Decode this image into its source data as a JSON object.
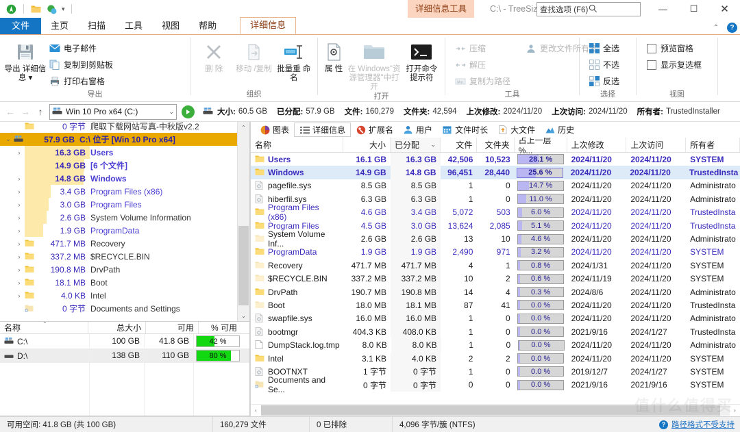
{
  "titlebar": {
    "context_tab_title": "详细信息工具",
    "window_title": "C:\\ - TreeSize",
    "search_placeholder": "查找选项 (F6)",
    "minimize": "—",
    "maximize": "☐",
    "close": "✕"
  },
  "ribbon_tabs": [
    {
      "label": "文件",
      "type": "file"
    },
    {
      "label": "主页",
      "type": "normal"
    },
    {
      "label": "扫描",
      "type": "normal"
    },
    {
      "label": "工具",
      "type": "normal"
    },
    {
      "label": "视图",
      "type": "normal"
    },
    {
      "label": "帮助",
      "type": "normal"
    },
    {
      "label": "详细信息",
      "type": "contextual"
    }
  ],
  "ribbon": {
    "groups": [
      {
        "label": "导出",
        "big": [
          {
            "label": "导出 详细信息 ▾",
            "icon": "save-disk-icon",
            "disabled": false
          }
        ],
        "small": [
          {
            "label": "电子邮件",
            "icon": "envelope-icon",
            "disabled": false
          },
          {
            "label": "复制到剪贴板",
            "icon": "copy-icon",
            "disabled": false
          },
          {
            "label": "打印右窗格",
            "icon": "printer-icon",
            "disabled": false
          }
        ]
      },
      {
        "label": "组织",
        "big": [
          {
            "label": "删 除",
            "icon": "delete-x-icon",
            "disabled": true
          },
          {
            "label": "移动 /复制",
            "icon": "move-copy-icon",
            "disabled": true
          },
          {
            "label": "批量重 命名",
            "icon": "rename-icon",
            "disabled": false
          }
        ],
        "small": []
      },
      {
        "label": "打开",
        "big": [
          {
            "label": "属 性",
            "icon": "properties-icon",
            "disabled": false
          },
          {
            "label": "在 Windows\"资 源管理器\"中打开",
            "icon": "folder-open-icon",
            "disabled": true
          },
          {
            "label": "打开命令 提示符",
            "icon": "console-icon",
            "disabled": false
          }
        ],
        "small": []
      },
      {
        "label": "工具",
        "big": [],
        "small": [
          {
            "label": "压缩",
            "icon": "compress-icon",
            "disabled": true
          },
          {
            "label": "解压",
            "icon": "extract-icon",
            "disabled": true
          },
          {
            "label": "复制为路径",
            "icon": "copy-path-icon",
            "disabled": true
          },
          {
            "label": "更改文件所有者",
            "icon": "change-owner-icon",
            "disabled": true
          }
        ]
      },
      {
        "label": "选择",
        "big": [],
        "small": [
          {
            "label": "全选",
            "icon": "select-all-icon",
            "disabled": false
          },
          {
            "label": "不选",
            "icon": "select-none-icon",
            "disabled": false
          },
          {
            "label": "反选",
            "icon": "invert-selection-icon",
            "disabled": false
          }
        ]
      },
      {
        "label": "视图",
        "big": [],
        "small": [
          {
            "label": "预览窗格",
            "icon": "checkbox-icon",
            "checked": false
          },
          {
            "label": "显示复选框",
            "icon": "checkbox-icon",
            "checked": false
          }
        ]
      }
    ]
  },
  "pathbar": {
    "back": "←",
    "forward": "→",
    "up": "↑",
    "drive_value": "Win 10 Pro x64 (C:)",
    "go": "▶",
    "info": [
      {
        "label": "大小:",
        "value": "60.5 GB"
      },
      {
        "label": "已分配:",
        "value": "57.9 GB"
      },
      {
        "label": "文件:",
        "value": "160,279"
      },
      {
        "label": "文件夹:",
        "value": "42,594"
      },
      {
        "label": "上次修改:",
        "value": "2024/11/20"
      },
      {
        "label": "上次访问:",
        "value": "2024/11/20"
      },
      {
        "label": "所有者:",
        "value": "TrustedInstaller"
      }
    ]
  },
  "tree": {
    "rows": [
      {
        "size": "0 字节",
        "name": "爬取下载网站写真-中秋版v2.2",
        "indent": 1,
        "expander": "",
        "icon": "folder-icon",
        "bar": 0,
        "clipped": true,
        "bold": false,
        "gray": true
      },
      {
        "size": "57.9 GB",
        "name": "C:\\ 位于  [Win 10 Pro x64]",
        "indent": 0,
        "expander": "⌄",
        "icon": "drive-icon",
        "bar": 0,
        "selected": true,
        "bold": true
      },
      {
        "size": "16.3 GB",
        "name": "Users",
        "indent": 1,
        "expander": "›",
        "icon": "folder-icon",
        "bar": 95,
        "bold": true
      },
      {
        "size": "14.9 GB",
        "name": "[6 个文件]",
        "indent": 1,
        "expander": "",
        "icon": "file-icon",
        "bar": 87,
        "bold": true
      },
      {
        "size": "14.8 GB",
        "name": "Windows",
        "indent": 1,
        "expander": "›",
        "icon": "folder-icon",
        "bar": 86,
        "bold": true
      },
      {
        "size": "3.4 GB",
        "name": "Program Files (x86)",
        "indent": 1,
        "expander": "›",
        "icon": "folder-icon",
        "bar": 38,
        "bold": false
      },
      {
        "size": "3.0 GB",
        "name": "Program Files",
        "indent": 1,
        "expander": "›",
        "icon": "folder-icon",
        "bar": 35,
        "bold": false
      },
      {
        "size": "2.6 GB",
        "name": "System Volume Information",
        "indent": 1,
        "expander": "›",
        "icon": "folder-icon",
        "bar": 32,
        "bold": false,
        "gray": true
      },
      {
        "size": "1.9 GB",
        "name": "ProgramData",
        "indent": 1,
        "expander": "›",
        "icon": "folder-icon",
        "bar": 27,
        "bold": false
      },
      {
        "size": "471.7 MB",
        "name": "Recovery",
        "indent": 1,
        "expander": "›",
        "icon": "folder-icon",
        "bar": 0,
        "bold": false,
        "gray": true
      },
      {
        "size": "337.2 MB",
        "name": "$RECYCLE.BIN",
        "indent": 1,
        "expander": "›",
        "icon": "folder-icon",
        "bar": 0,
        "bold": false,
        "gray": true
      },
      {
        "size": "190.8 MB",
        "name": "DrvPath",
        "indent": 1,
        "expander": "›",
        "icon": "folder-icon",
        "bar": 0,
        "bold": false,
        "gray": true
      },
      {
        "size": "18.1 MB",
        "name": "Boot",
        "indent": 1,
        "expander": "›",
        "icon": "folder-icon",
        "bar": 0,
        "bold": false,
        "gray": true
      },
      {
        "size": "4.0 KB",
        "name": "Intel",
        "indent": 1,
        "expander": "›",
        "icon": "folder-icon",
        "bar": 0,
        "bold": false,
        "gray": true
      },
      {
        "size": "0 字节",
        "name": "Documents and Settings",
        "indent": 1,
        "expander": "",
        "icon": "shortcut-folder-icon",
        "bar": 0,
        "bold": false,
        "gray": true
      }
    ]
  },
  "drives": {
    "headers": [
      "名称",
      "总大小",
      "可用",
      "% 可用"
    ],
    "rows": [
      {
        "name": "C:\\",
        "icon": "drive-icon",
        "total": "100 GB",
        "free": "41.8 GB",
        "pct": "42 %",
        "pct_value": 42
      },
      {
        "name": "D:\\",
        "icon": "drive-plain-icon",
        "total": "138 GB",
        "free": "110 GB",
        "pct": "80 %",
        "pct_value": 80
      }
    ]
  },
  "view_tabs": [
    {
      "label": "图表",
      "icon": "piechart-icon",
      "active": false
    },
    {
      "label": "详细信息",
      "icon": "details-icon",
      "active": true
    },
    {
      "label": "扩展名",
      "icon": "extension-icon",
      "active": false
    },
    {
      "label": "用户",
      "icon": "users-icon",
      "active": false
    },
    {
      "label": "文件时长",
      "icon": "calendar-icon",
      "active": false
    },
    {
      "label": "大文件",
      "icon": "topfiles-icon",
      "active": false
    },
    {
      "label": "历史",
      "icon": "history-icon",
      "active": false
    }
  ],
  "grid": {
    "headers": [
      {
        "label": "名称",
        "key": "name"
      },
      {
        "label": "大小",
        "key": "size"
      },
      {
        "label": "已分配",
        "key": "alloc",
        "sorted": true,
        "sort_glyph": "⌄"
      },
      {
        "label": "文件",
        "key": "files"
      },
      {
        "label": "文件夹",
        "key": "folders"
      },
      {
        "label": "占上一层 %...",
        "key": "pct"
      },
      {
        "label": "上次修改",
        "key": "modified"
      },
      {
        "label": "上次访问",
        "key": "accessed"
      },
      {
        "label": "所有者",
        "key": "owner"
      }
    ],
    "rows": [
      {
        "name": "Users",
        "icon": "folder-icon",
        "size": "16.1 GB",
        "alloc": "16.3 GB",
        "files": "42,506",
        "folders": "10,523",
        "pct": "28.1 %",
        "pct_value": 28.1,
        "modified": "2024/11/20",
        "accessed": "2024/11/20",
        "owner": "SYSTEM",
        "bold": true,
        "selected": false
      },
      {
        "name": "Windows",
        "icon": "folder-icon",
        "size": "14.9 GB",
        "alloc": "14.8 GB",
        "files": "96,451",
        "folders": "28,440",
        "pct": "25.6 %",
        "pct_value": 25.6,
        "modified": "2024/11/20",
        "accessed": "2024/11/20",
        "owner": "TrustedInsta",
        "bold": true,
        "selected": true
      },
      {
        "name": "pagefile.sys",
        "icon": "sysfile-icon",
        "size": "8.5 GB",
        "alloc": "8.5 GB",
        "files": "1",
        "folders": "0",
        "pct": "14.7 %",
        "pct_value": 14.7,
        "modified": "2024/11/20",
        "accessed": "2024/11/20",
        "owner": "Administrato",
        "bold": false,
        "dark": true
      },
      {
        "name": "hiberfil.sys",
        "icon": "sysfile-icon",
        "size": "6.3 GB",
        "alloc": "6.3 GB",
        "files": "1",
        "folders": "0",
        "pct": "11.0 %",
        "pct_value": 11.0,
        "modified": "2024/11/20",
        "accessed": "2024/11/20",
        "owner": "Administrato",
        "bold": false,
        "dark": true
      },
      {
        "name": "Program Files (x86)",
        "icon": "folder-icon",
        "size": "4.6 GB",
        "alloc": "3.4 GB",
        "files": "5,072",
        "folders": "503",
        "pct": "6.0 %",
        "pct_value": 6.0,
        "modified": "2024/11/20",
        "accessed": "2024/11/20",
        "owner": "TrustedInsta",
        "bold": false
      },
      {
        "name": "Program Files",
        "icon": "folder-icon",
        "size": "4.5 GB",
        "alloc": "3.0 GB",
        "files": "13,624",
        "folders": "2,085",
        "pct": "5.1 %",
        "pct_value": 5.1,
        "modified": "2024/11/20",
        "accessed": "2024/11/20",
        "owner": "TrustedInsta",
        "bold": false
      },
      {
        "name": "System Volume Inf...",
        "icon": "folder-pale-icon",
        "size": "2.6 GB",
        "alloc": "2.6 GB",
        "files": "13",
        "folders": "10",
        "pct": "4.6 %",
        "pct_value": 4.6,
        "modified": "2024/11/20",
        "accessed": "2024/11/20",
        "owner": "Administrato",
        "bold": false,
        "dark": true
      },
      {
        "name": "ProgramData",
        "icon": "folder-icon",
        "size": "1.9 GB",
        "alloc": "1.9 GB",
        "files": "2,490",
        "folders": "971",
        "pct": "3.2 %",
        "pct_value": 3.2,
        "modified": "2024/11/20",
        "accessed": "2024/11/20",
        "owner": "SYSTEM",
        "bold": false
      },
      {
        "name": "Recovery",
        "icon": "folder-pale-icon",
        "size": "471.7 MB",
        "alloc": "471.7 MB",
        "files": "4",
        "folders": "1",
        "pct": "0.8 %",
        "pct_value": 0.8,
        "modified": "2024/1/31",
        "accessed": "2024/11/20",
        "owner": "SYSTEM",
        "bold": false,
        "dark": true
      },
      {
        "name": "$RECYCLE.BIN",
        "icon": "folder-pale-icon",
        "size": "337.2 MB",
        "alloc": "337.2 MB",
        "files": "10",
        "folders": "2",
        "pct": "0.6 %",
        "pct_value": 0.6,
        "modified": "2024/11/19",
        "accessed": "2024/11/20",
        "owner": "SYSTEM",
        "bold": false,
        "dark": true
      },
      {
        "name": "DrvPath",
        "icon": "folder-icon",
        "size": "190.7 MB",
        "alloc": "190.8 MB",
        "files": "14",
        "folders": "4",
        "pct": "0.3 %",
        "pct_value": 0.3,
        "modified": "2024/8/6",
        "accessed": "2024/11/20",
        "owner": "Administrato",
        "bold": false,
        "dark": true
      },
      {
        "name": "Boot",
        "icon": "folder-pale-icon",
        "size": "18.0 MB",
        "alloc": "18.1 MB",
        "files": "87",
        "folders": "41",
        "pct": "0.0 %",
        "pct_value": 0.0,
        "modified": "2024/11/20",
        "accessed": "2024/11/20",
        "owner": "TrustedInsta",
        "bold": false,
        "dark": true
      },
      {
        "name": "swapfile.sys",
        "icon": "sysfile-icon",
        "size": "16.0 MB",
        "alloc": "16.0 MB",
        "files": "1",
        "folders": "0",
        "pct": "0.0 %",
        "pct_value": 0.0,
        "modified": "2024/11/20",
        "accessed": "2024/11/20",
        "owner": "Administrato",
        "bold": false,
        "dark": true
      },
      {
        "name": "bootmgr",
        "icon": "sysfile-icon",
        "size": "404.3 KB",
        "alloc": "408.0 KB",
        "files": "1",
        "folders": "0",
        "pct": "0.0 %",
        "pct_value": 0.0,
        "modified": "2021/9/16",
        "accessed": "2024/1/27",
        "owner": "TrustedInsta",
        "bold": false,
        "dark": true
      },
      {
        "name": "DumpStack.log.tmp",
        "icon": "file-icon",
        "size": "8.0 KB",
        "alloc": "8.0 KB",
        "files": "1",
        "folders": "0",
        "pct": "0.0 %",
        "pct_value": 0.0,
        "modified": "2024/11/20",
        "accessed": "2024/11/20",
        "owner": "Administrato",
        "bold": false,
        "dark": true
      },
      {
        "name": "Intel",
        "icon": "folder-icon",
        "size": "3.1 KB",
        "alloc": "4.0 KB",
        "files": "2",
        "folders": "2",
        "pct": "0.0 %",
        "pct_value": 0.0,
        "modified": "2024/11/20",
        "accessed": "2024/11/20",
        "owner": "SYSTEM",
        "bold": false,
        "dark": true
      },
      {
        "name": "BOOTNXT",
        "icon": "sysfile-icon",
        "size": "1 字节",
        "alloc": "0 字节",
        "files": "1",
        "folders": "0",
        "pct": "0.0 %",
        "pct_value": 0.0,
        "modified": "2019/12/7",
        "accessed": "2024/1/27",
        "owner": "SYSTEM",
        "bold": false,
        "dark": true
      },
      {
        "name": "Documents and Se...",
        "icon": "shortcut-folder-icon",
        "size": "0 字节",
        "alloc": "0 字节",
        "files": "0",
        "folders": "0",
        "pct": "0.0 %",
        "pct_value": 0.0,
        "modified": "2021/9/16",
        "accessed": "2021/9/16",
        "owner": "SYSTEM",
        "bold": false,
        "dark": true
      }
    ]
  },
  "status": {
    "free_space": "可用空间: 41.8 GB (共 100 GB)",
    "file_count": "160,279 文件",
    "excluded": "0 已排除",
    "cluster": "4,096 字节/簇 (NTFS)",
    "hint": "路径格式不受支持",
    "hint_icon": "info-icon"
  },
  "colors": {
    "accent_blue": "#1475c4",
    "selected_gold": "#e9a900",
    "tree_bar": "#fde9a9",
    "pct_bar": "#b9b6f2",
    "free_bar_green": "#11d811",
    "contextual_orange": "#8a3b10",
    "link_blue": "#1a6fc4"
  },
  "watermark": "值什么值得买"
}
